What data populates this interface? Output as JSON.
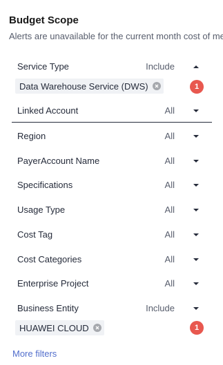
{
  "title": "Budget Scope",
  "subtitle": "Alerts are unavailable for the current month cost of me",
  "filters": [
    {
      "label": "Service Type",
      "value": "Include",
      "tag": "Data Warehouse Service (DWS)",
      "badge": "1"
    },
    {
      "label": "Linked Account",
      "value": "All"
    },
    {
      "label": "Region",
      "value": "All"
    },
    {
      "label": "PayerAccount Name",
      "value": "All"
    },
    {
      "label": "Specifications",
      "value": "All"
    },
    {
      "label": "Usage Type",
      "value": "All"
    },
    {
      "label": "Cost Tag",
      "value": "All"
    },
    {
      "label": "Cost Categories",
      "value": "All"
    },
    {
      "label": "Enterprise Project",
      "value": "All"
    },
    {
      "label": "Business Entity",
      "value": "Include",
      "tag": "HUAWEI CLOUD",
      "badge": "1"
    }
  ],
  "more_filters": "More filters",
  "colors": {
    "badge": "#e8584f",
    "link": "#526ecc",
    "tag_bg": "#f0f2f5"
  }
}
